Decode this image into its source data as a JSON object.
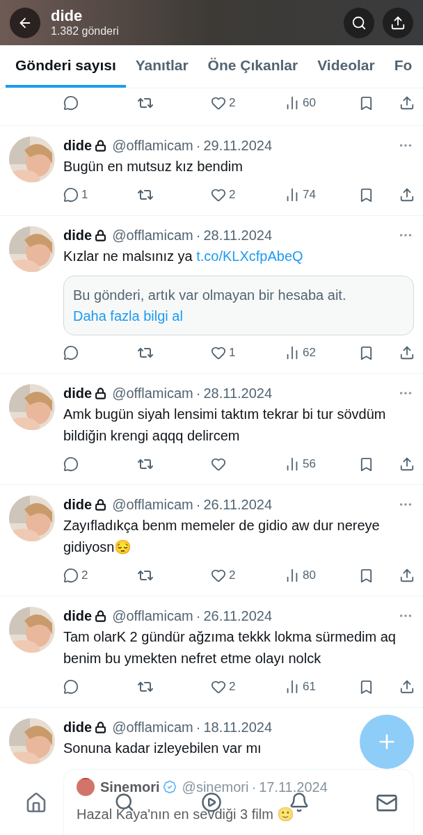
{
  "header": {
    "title": "dide",
    "subtitle": "1.382 gönderi"
  },
  "tabs": [
    {
      "label": "Gönderi sayısı",
      "selected": true
    },
    {
      "label": "Yanıtlar",
      "selected": false
    },
    {
      "label": "Öne Çıkanlar",
      "selected": false
    },
    {
      "label": "Videolar",
      "selected": false
    },
    {
      "label": "Fo",
      "selected": false
    }
  ],
  "posts": [
    {
      "kind": "partial",
      "likes": "2",
      "views": "60"
    },
    {
      "kind": "post",
      "name": "dide",
      "locked": true,
      "handle": "@offlamicam",
      "dot": "·",
      "date": "29.11.2024",
      "text": "Bugün en mutsuz kız bendim",
      "replies": "1",
      "likes": "2",
      "views": "74"
    },
    {
      "kind": "post",
      "name": "dide",
      "locked": true,
      "handle": "@offlamicam",
      "dot": "·",
      "date": "28.11.2024",
      "text": "Kızlar ne malsınız ya",
      "link": "t.co/KLXcfpAbeQ",
      "notice": {
        "text": "Bu gönderi, artık var olmayan bir hesaba ait.",
        "link": "Daha fazla bilgi al"
      },
      "likes": "1",
      "views": "62"
    },
    {
      "kind": "post",
      "name": "dide",
      "locked": true,
      "handle": "@offlamicam",
      "dot": "·",
      "date": "28.11.2024",
      "text": "Amk bugün siyah lensimi taktım tekrar bi tur sövdüm bildiğin krengi aqqq delircem",
      "views": "56"
    },
    {
      "kind": "post",
      "name": "dide",
      "locked": true,
      "handle": "@offlamicam",
      "dot": "·",
      "date": "26.11.2024",
      "text": "Zayıfladıkça benm memeler de gidio aw dur nereye gidiyosn😔",
      "replies": "2",
      "likes": "2",
      "views": "80"
    },
    {
      "kind": "post",
      "name": "dide",
      "locked": true,
      "handle": "@offlamicam",
      "dot": "·",
      "date": "26.11.2024",
      "text": "Tam olarK 2 gündür ağzıma tekkk lokma sürmedim aq benim bu ymekten nefret etme olayı nolck",
      "likes": "2",
      "views": "61"
    },
    {
      "kind": "cut",
      "name": "dide",
      "locked": true,
      "handle": "@offlamicam",
      "dot": "·",
      "date": "18.11.2024",
      "text": "Sonuna kadar izleyebilen var mı",
      "quote": {
        "name": "Sinemori",
        "verified": true,
        "handle": "@sinemori",
        "dot": "·",
        "date": "17.11.2024",
        "text": "Hazal Kaya'nın en sevdiği 3 film 🙂"
      }
    }
  ]
}
